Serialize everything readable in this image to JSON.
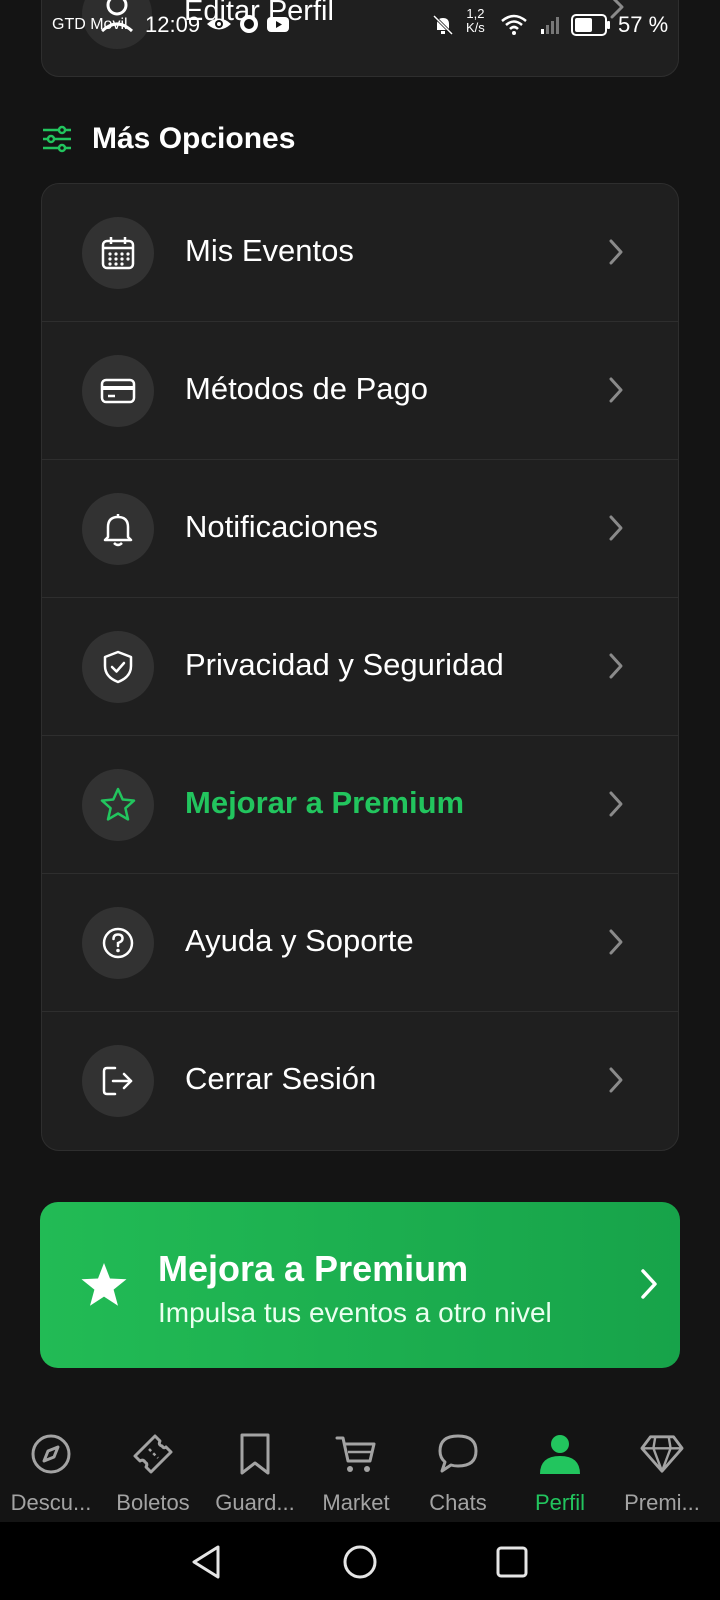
{
  "status_bar": {
    "carrier": "GTD Movil",
    "time": "12:09",
    "net_speed_value": "1,2",
    "net_speed_unit": "K/s",
    "battery": "57 %"
  },
  "top_card": {
    "label": "Editar Perfil"
  },
  "section": {
    "title": "Más Opciones"
  },
  "options": [
    {
      "label": "Mis Eventos",
      "icon": "calendar-icon"
    },
    {
      "label": "Métodos de Pago",
      "icon": "credit-card-icon"
    },
    {
      "label": "Notificaciones",
      "icon": "bell-icon"
    },
    {
      "label": "Privacidad y Seguridad",
      "icon": "shield-check-icon"
    },
    {
      "label": "Mejorar a Premium",
      "icon": "star-icon"
    },
    {
      "label": "Ayuda y Soporte",
      "icon": "help-circle-icon"
    },
    {
      "label": "Cerrar Sesión",
      "icon": "logout-icon"
    }
  ],
  "banner": {
    "title": "Mejora a Premium",
    "subtitle": "Impulsa tus eventos a otro nivel"
  },
  "bottom_nav": [
    {
      "label": "Descu...",
      "icon": "compass-icon"
    },
    {
      "label": "Boletos",
      "icon": "ticket-icon"
    },
    {
      "label": "Guard...",
      "icon": "bookmark-icon"
    },
    {
      "label": "Market",
      "icon": "cart-icon"
    },
    {
      "label": "Chats",
      "icon": "chat-bubble-icon"
    },
    {
      "label": "Perfil",
      "icon": "person-icon",
      "active": true
    },
    {
      "label": "Premi...",
      "icon": "diamond-icon"
    }
  ],
  "colors": {
    "background": "#141414",
    "card": "#1f1f1f",
    "accent": "#22c55e",
    "muted": "#a3a3a3"
  }
}
